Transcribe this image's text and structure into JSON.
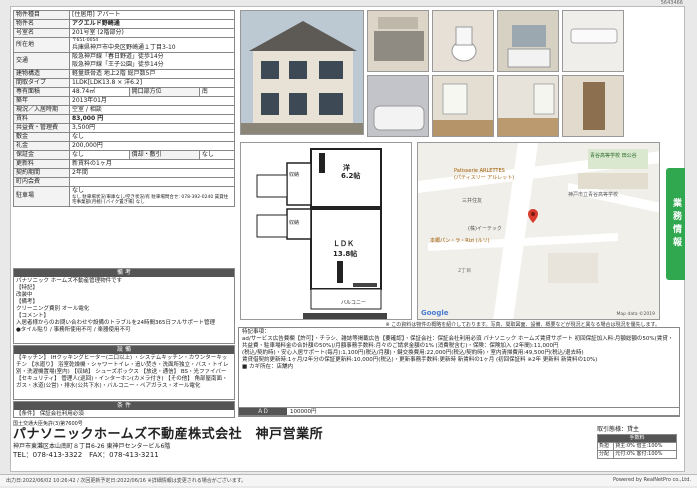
{
  "doc_id": "5643466",
  "spec": {
    "type_label": "物件種目",
    "type_value": "[住居用] アパート",
    "name_label": "物件名",
    "name_value": "アクエルド野崎通",
    "room_label": "号室名",
    "room_value": "201号室 (2階部分)",
    "addr_label": "所在地",
    "zip": "〒651-0054",
    "addr_value": "兵庫県神戸市中央区野崎通１丁目3-10",
    "traffic_label": "交通",
    "traffic_1": "阪急神戸線「春日野道」徒歩14分",
    "traffic_2": "阪急神戸線「王子公園」徒歩14分",
    "struct_label": "建物構造",
    "struct_value": "軽量鉄骨造 地上2階 総戸数5戸",
    "layout_label": "間取タイプ",
    "layout_value": "1LDK[LDK13.8 × 洋6.2]",
    "area_label": "専有面積",
    "area_value": "48.74㎡",
    "open_label": "開口部方位",
    "open_value": "南",
    "built_label": "築年",
    "built_value": "2013年01月",
    "status_label": "現況／入居時期",
    "status_value": "空室 / 相談",
    "rent_label": "賃料",
    "rent_value": "83,000 円",
    "fee_label": "共益費・管理費",
    "fee_value": "3,500円",
    "deposit_label": "敷金",
    "deposit_value": "なし",
    "key_label": "礼金",
    "key_value": "200,000円",
    "hosho_label": "保証金",
    "hosho_value": "なし",
    "shokyaku_label": "償却・敷引",
    "shokyaku_value": "なし",
    "renew_label": "更新料",
    "renew_value": "新賃料の1ヶ月",
    "period_label": "契約期間",
    "period_value": "2年間",
    "insurance_label": "町内会費",
    "insurance_value": "",
    "parking_label": "駐車場",
    "parking_value": "なし",
    "parking_note": "なし 駐車場状況/車庫なし/空き状況/有 駐車場問合せ: 078-392-0240 賃貸住宅事業部(月極) [バイク置き場] なし"
  },
  "remarks": {
    "title": "備 考",
    "lines": [
      "パナソニック ホームズ不動産管理物件です",
      "【特記】",
      "改装中",
      "【備考】",
      "クリーニング費別 オール電化",
      "【コメント】",
      "入居者様からのお問い合わせや設備のトラブルを24時間365日フルサポート管理",
      "",
      "●タイル貼り / 事務所使用不可 / 楽器使用不可"
    ]
  },
  "equipment": {
    "title": "設 備",
    "text": "【キッチン】 IHクッキングヒーター(二口以上) ・システムキッチン・カウンターキッチン 【水廻り】 浴室乾燥機・シャワートイレ・追い焚き・洗面所独立・バス・トイレ別・洗濯機置場(室内) 【収納】 シューズボックス 【放送・通信】 BS・光ファイバー 【セキュリティ】 管理人(巡回)・インターホン(カメラ付き) 【その他】 角部屋南面・ガス・水道(公営)・排水(公共下水)・バルコニー・ペアガラス・オール電化"
  },
  "conditions": {
    "title": "条 件",
    "text": "【条件】 保証会社利用必須"
  },
  "floor": {
    "room1": "洋",
    "room1_size": "6.2帖",
    "ldk": "ＬＤＫ",
    "ldk_size": "13.8帖",
    "balcony": "バルコニー",
    "shunou": "収納",
    "shunou2": "収納"
  },
  "map": {
    "school": "青谷高等学校 田公谷",
    "label1": "Patisserie ARLETTES",
    "label2": "(パティスリー アルレット)",
    "label3": "三井住友",
    "label4": "(株)イーテック",
    "label5": "本郷パン・ラ・Rizi (ルリ)",
    "label6": "2丁目",
    "label7": "神戸市立青谷高等学校",
    "copyright": "Map data ©2019",
    "google": "Google"
  },
  "map_note": "※ この資料は物件の概略を紹介しております。写真、間取図面、設備、概要などが現況と異なる場合は現況を優先します。",
  "special": {
    "title": "特記事項：",
    "lines": [
      "ad/サービス広告費欄【許可】・チラシ、雑誌等掲載広告【要確認】・保証会社：保証会社利用必須 パナソニック ホームズ賃貸サポート 初回保証加入料:月額総額の50%(賃貸・共益費・駐車場料金の合計額の50%)/月額事務手数料:月々のご請求金額の1% (消費税含む)・保険：保険加入 (2年間):11,000円",
      "(税込/契約時)・安心入居サポート(毎月):1,100円(税込/月額)・鍵交換費用:22,000円(税込/契約時)・室内清掃費用:49,500円(税込/退去時)",
      "賃貸借契約更新時:1ヶ月/2年分の保証更新料:10,000円(税込)・更新事務手数料:更新時 新賃料の1ヶ月 (初回保証料 ※2年 更新料 新賃料の10%)"
    ],
    "owner": "■ カギ所在：店舗内"
  },
  "ad": {
    "label": "ＡＤ",
    "value": "100000円"
  },
  "tab_label": "業務情報",
  "company": {
    "license": "国土交通大臣免許(3)第7600号",
    "name": "パナソニックホームズ不動産株式会社　神戸営業所",
    "addr": "神戸市東灘区本山南町８丁目6-26 東神戸センタービル6階",
    "tel": "TEL：078-413-3322　FAX：078-413-3211"
  },
  "txn": {
    "title": "取引態様：貸主",
    "fee_title": "手数料",
    "row1_a": "負担",
    "row1_b": "貸主:0% 借主:100%",
    "row2_a": "分配",
    "row2_b": "元付:0% 客付:100%"
  },
  "footer": {
    "left": "出力日:2022/06/02 10:26:42 / 次回更新予定日:2022/06/16 ※詳細情報は変更される場合がございます。",
    "right": "Powered by RealNetPro co.,Ltd."
  },
  "colors": {
    "accent_tab": "#2fa84f",
    "section_head": "#555555"
  }
}
